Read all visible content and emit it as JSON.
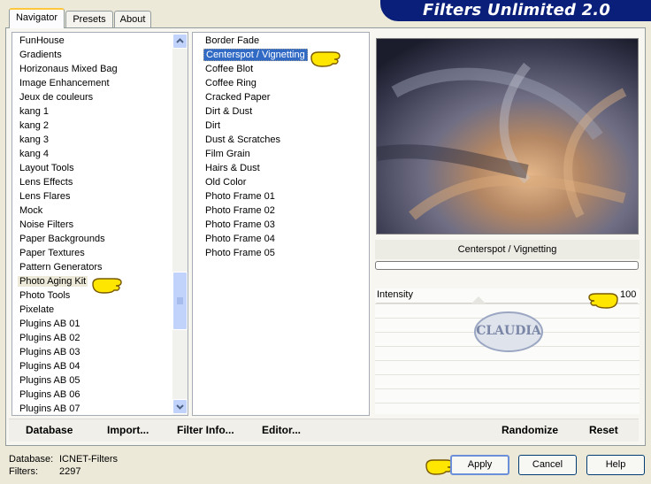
{
  "tabs": [
    {
      "label": "Navigator"
    },
    {
      "label": "Presets"
    },
    {
      "label": "About"
    }
  ],
  "banner": {
    "title": "Filters Unlimited 2.0"
  },
  "categories": [
    "FunHouse",
    "Gradients",
    "Horizonaus Mixed Bag",
    "Image Enhancement",
    "Jeux de couleurs",
    "kang 1",
    "kang 2",
    "kang 3",
    "kang 4",
    "Layout Tools",
    "Lens Effects",
    "Lens Flares",
    "Mock",
    "Noise Filters",
    "Paper Backgrounds",
    "Paper Textures",
    "Pattern Generators",
    "Photo Aging Kit",
    "Photo Tools",
    "Pixelate",
    "Plugins AB 01",
    "Plugins AB 02",
    "Plugins AB 03",
    "Plugins AB 04",
    "Plugins AB 05",
    "Plugins AB 06",
    "Plugins AB 07"
  ],
  "filters": [
    "Border Fade",
    "Centerspot / Vignetting",
    "Coffee Blot",
    "Coffee Ring",
    "Cracked Paper",
    "Dirt & Dust",
    "Dirt",
    "Dust & Scratches",
    "Film Grain",
    "Hairs & Dust",
    "Old Color",
    "Photo Frame 01",
    "Photo Frame 02",
    "Photo Frame 03",
    "Photo Frame 04",
    "Photo Frame 05"
  ],
  "selected_category": "Photo Aging Kit",
  "selected_filter": "Centerspot / Vignetting",
  "current_filter": "Centerspot / Vignetting",
  "slider": {
    "label": "Intensity",
    "value": "100"
  },
  "watermark": "CLAUDIA",
  "links": {
    "database": "Database",
    "import": "Import...",
    "filter_info": "Filter Info...",
    "editor": "Editor...",
    "randomize": "Randomize",
    "reset": "Reset"
  },
  "buttons": {
    "apply": "Apply",
    "cancel": "Cancel",
    "help": "Help"
  },
  "footer": {
    "database_label": "Database:",
    "database_value": "ICNET-Filters",
    "filters_label": "Filters:",
    "filters_value": "2297"
  },
  "colors": {
    "selection": "#316ac5",
    "banner": "#0a1f7a",
    "pointer": "#ffe600"
  }
}
